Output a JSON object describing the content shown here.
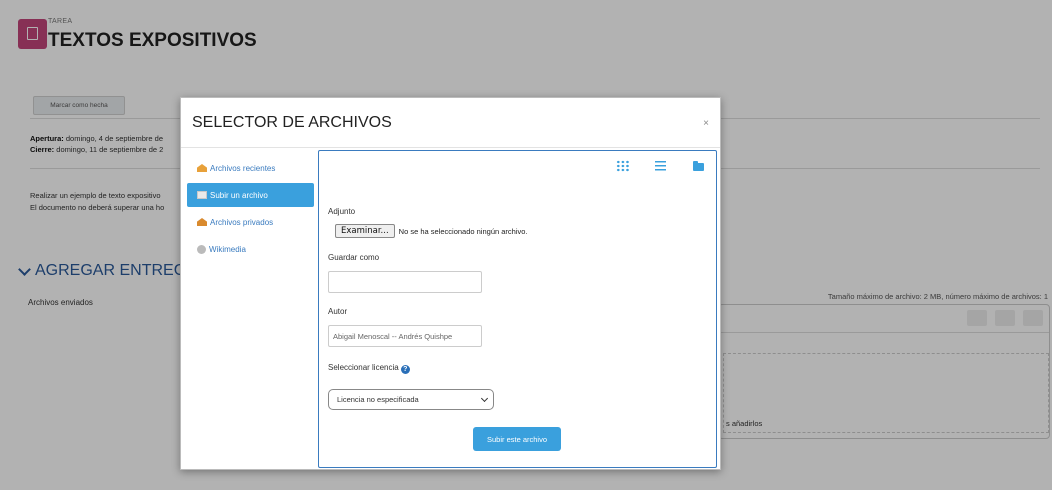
{
  "page": {
    "kicker": "TAREA",
    "title": "TEXTOS EXPOSITIVOS",
    "mark_done_label": "Marcar como hecha",
    "opening_label": "Apertura:",
    "opening_value": " domingo, 4 de septiembre de",
    "closing_label": "Cierre:",
    "closing_value": " domingo, 11 de septiembre de 2",
    "desc_line1": "Realizar un ejemplo de texto expositivo",
    "desc_line2": "El documento no deberá superar una ho",
    "section_title": "AGREGAR ENTREGA",
    "sent_files_label": "Archivos enviados",
    "size_info": "Tamaño máximo de archivo: 2 MB, número máximo de archivos: 1",
    "drop_text": "s añadirlos"
  },
  "modal": {
    "title": "SELECTOR DE ARCHIVOS",
    "close": "×",
    "repositories": [
      {
        "label": "Archivos recientes",
        "icon": "recent-files-icon",
        "active": false
      },
      {
        "label": "Subir un archivo",
        "icon": "upload-icon",
        "active": true
      },
      {
        "label": "Archivos privados",
        "icon": "private-files-icon",
        "active": false
      },
      {
        "label": "Wikimedia",
        "icon": "wikimedia-icon",
        "active": false
      }
    ],
    "form": {
      "attachment_label": "Adjunto",
      "browse_label": "Examinar...",
      "no_file_text": "No se ha seleccionado ningún archivo.",
      "save_as_label": "Guardar como",
      "save_as_value": "",
      "author_label": "Autor",
      "author_value": "Abigail Menoscal -- Andrés Quishpe",
      "license_label": "Seleccionar licencia",
      "license_help": "?",
      "license_selected": "Licencia no especificada",
      "submit_label": "Subir este archivo"
    }
  },
  "colors": {
    "accent": "#3aa0dd",
    "link": "#3a7bbf",
    "task_icon": "#c2457a"
  }
}
